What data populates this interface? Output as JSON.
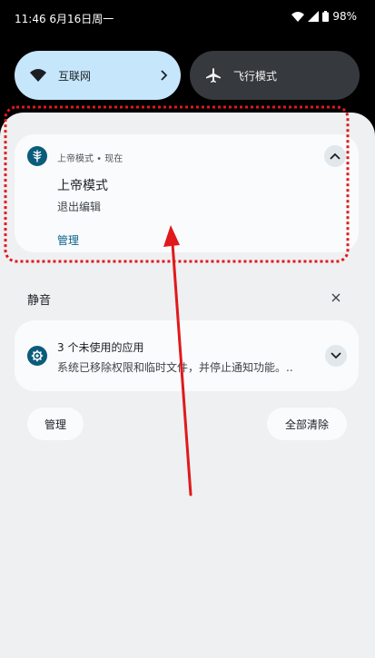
{
  "status_bar": {
    "time_date": "11:46 6月16日周一",
    "battery": "98%"
  },
  "quick_settings": {
    "internet": {
      "label": "互联网",
      "icon": "wifi-icon"
    },
    "airplane": {
      "label": "飞行模式",
      "icon": "airplane-icon"
    }
  },
  "notifications": {
    "god_mode": {
      "app": "上帝模式 • 现在",
      "title": "上帝模式",
      "text": "退出编辑",
      "action": "管理",
      "icon": "tree-icon"
    },
    "silent_section": {
      "title": "静音"
    },
    "unused_apps": {
      "title": "3 个未使用的应用",
      "text": "系统已移除权限和临时文件，并停止通知功能。..",
      "icon": "gear-icon"
    }
  },
  "footer": {
    "manage_label": "管理",
    "clear_all_label": "全部清除"
  },
  "colors": {
    "annotation_red": "#e0191b",
    "accent": "#0a6389",
    "internet_tile": "#c6e6fb"
  }
}
